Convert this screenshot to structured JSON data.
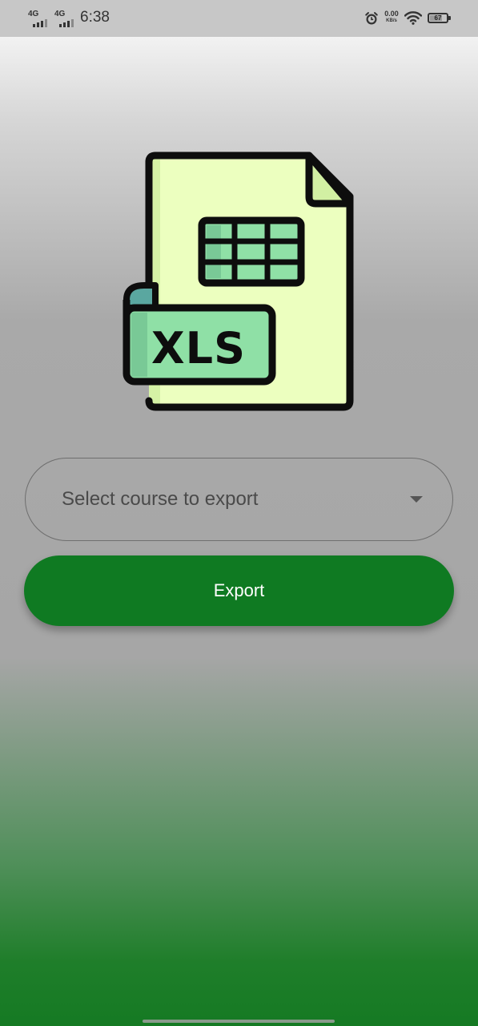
{
  "status_bar": {
    "sim1_label": "4G",
    "sim2_label": "4G",
    "time": "6:38",
    "net_speed_value": "0.00",
    "net_speed_unit": "KB/s",
    "battery_level": "67",
    "icons": [
      "signal-icon",
      "alarm-icon",
      "wifi-icon",
      "battery-icon"
    ]
  },
  "illustration": {
    "icon": "xls-file-icon",
    "label": "XLS",
    "colors": {
      "page": "#ecffbf",
      "accent": "#8fe0a6",
      "fold": "#5aa7a0",
      "outline": "#0d0d0d"
    }
  },
  "course_select": {
    "placeholder": "Select course to export",
    "icon": "dropdown-arrow-icon"
  },
  "export_button": {
    "label": "Export",
    "color": "#0f7a22"
  }
}
